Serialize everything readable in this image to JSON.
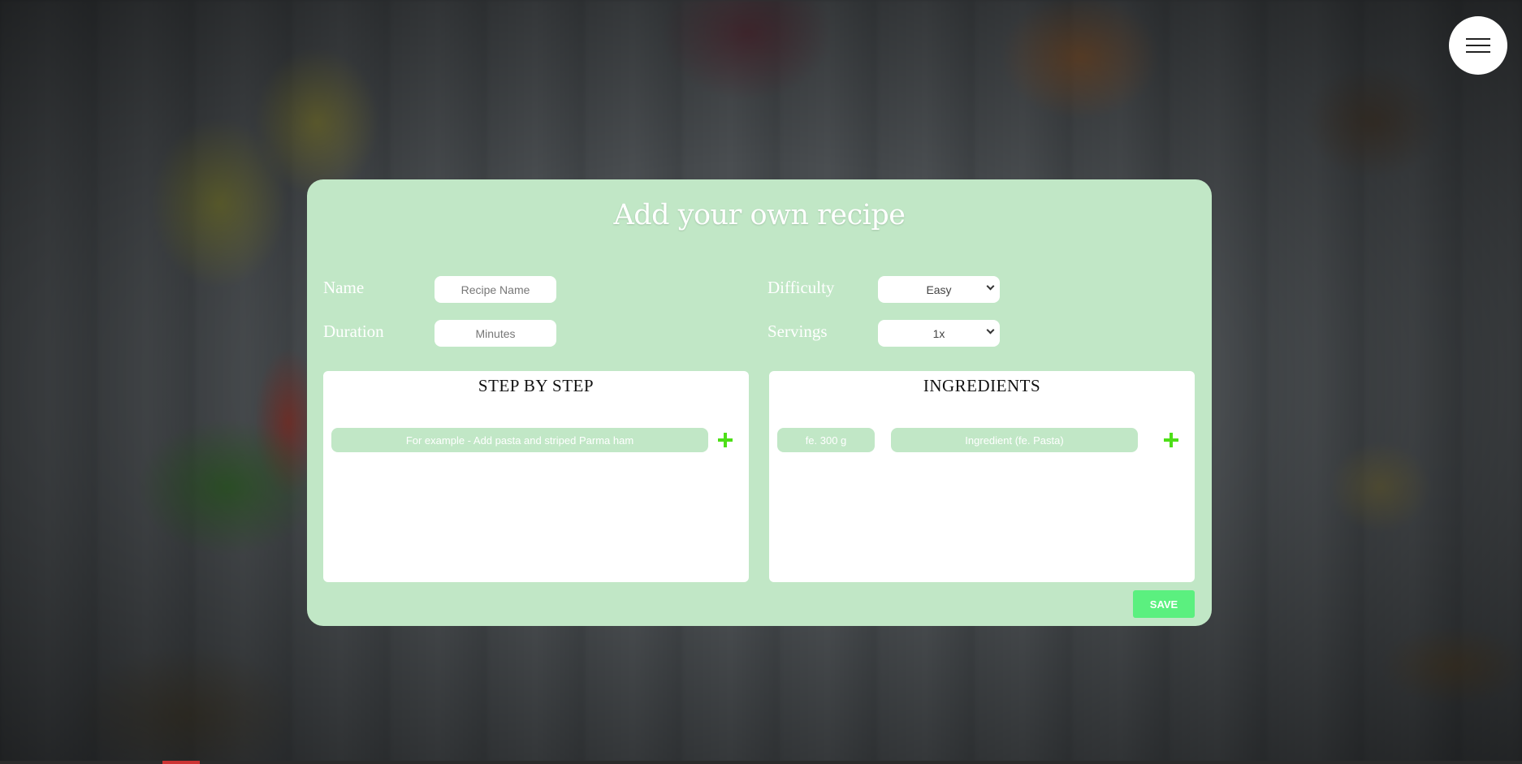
{
  "page": {
    "title": "Add your own recipe"
  },
  "form": {
    "name": {
      "label": "Name",
      "placeholder": "Recipe Name"
    },
    "duration": {
      "label": "Duration",
      "placeholder": "Minutes"
    },
    "difficulty": {
      "label": "Difficulty",
      "value": "Easy"
    },
    "servings": {
      "label": "Servings",
      "value": "1x"
    }
  },
  "steps": {
    "title": "STEP BY STEP",
    "step_placeholder": "For example - Add pasta and striped Parma ham"
  },
  "ingredients": {
    "title": "INGREDIENTS",
    "amount_placeholder": "fe. 300 g",
    "ingredient_placeholder": "Ingredient (fe. Pasta)"
  },
  "actions": {
    "save_label": "SAVE"
  },
  "colors": {
    "card_background": "#c1e7c6",
    "save_button": "#5bf07f",
    "add_icon": "#4ddf18"
  }
}
